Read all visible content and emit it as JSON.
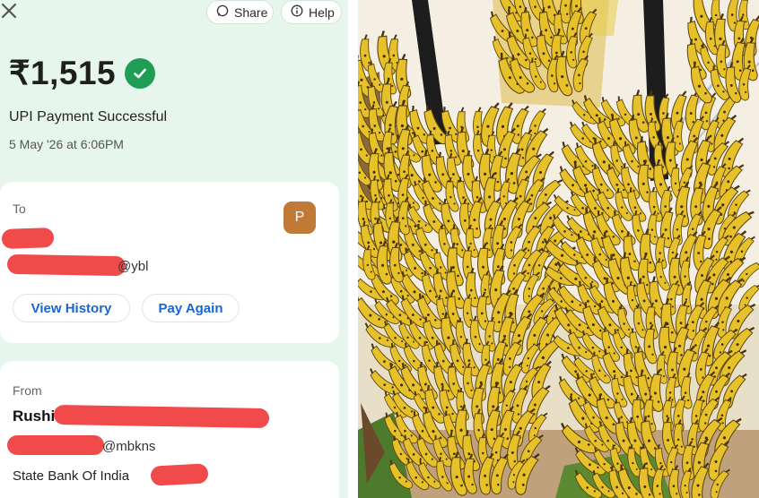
{
  "header": {
    "close_icon": "close-icon",
    "share_label": "Share",
    "share_icon": "whatsapp-icon",
    "help_label": "Help",
    "help_icon": "help-icon"
  },
  "payment": {
    "amount": "₹1,515",
    "status_icon": "check-circle-icon",
    "status": "UPI Payment Successful",
    "date": "5 May '26 at 6:06PM"
  },
  "to_card": {
    "label": "To",
    "avatar_letter": "P",
    "upi_suffix": "@ybl",
    "view_history": "View History",
    "pay_again": "Pay Again"
  },
  "from_card": {
    "label": "From",
    "name": "Rushi",
    "upi_suffix": "@mbkns",
    "bank": "State Bank Of India"
  },
  "colors": {
    "success_bg": "#e7f6ec",
    "success_green": "#1f9d55",
    "link_blue": "#1766d2",
    "redaction_red": "#ef3b3b",
    "avatar_brown": "#c07a35"
  }
}
